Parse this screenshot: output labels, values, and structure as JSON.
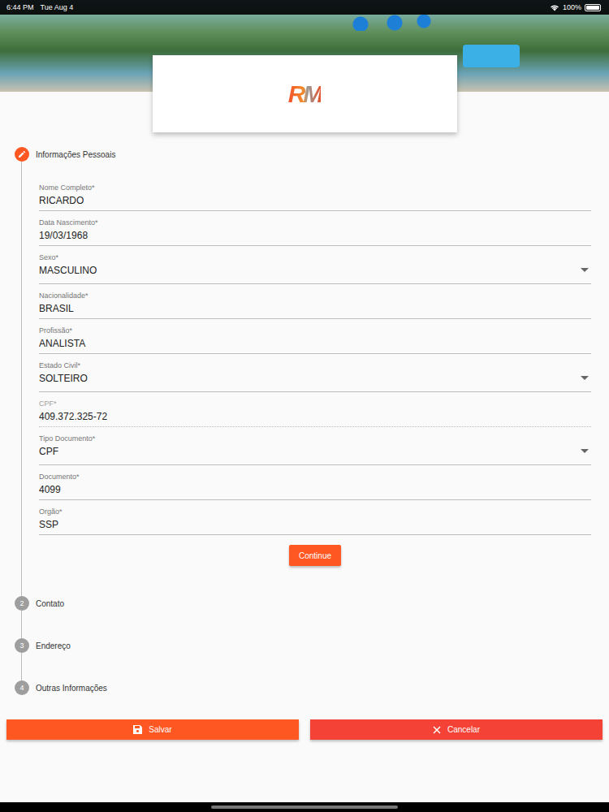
{
  "status_bar": {
    "time": "6:44 PM",
    "date": "Tue Aug 4",
    "battery": "100%",
    "battery_level": 1.0
  },
  "logo": {
    "text": "RM"
  },
  "steps": [
    {
      "label": "Informações Pessoais",
      "active": true,
      "number": ""
    },
    {
      "label": "Contato",
      "active": false,
      "number": "2"
    },
    {
      "label": "Endereço",
      "active": false,
      "number": "3"
    },
    {
      "label": "Outras Informações",
      "active": false,
      "number": "4"
    }
  ],
  "fields": [
    {
      "label": "Nome Completo*",
      "value": "RICARDO",
      "kind": "text",
      "disabled": false
    },
    {
      "label": "Data Nascimento*",
      "value": "19/03/1968",
      "kind": "text",
      "disabled": false
    },
    {
      "label": "Sexo*",
      "value": "MASCULINO",
      "kind": "select",
      "disabled": false
    },
    {
      "label": "Nacionalidade*",
      "value": "BRASIL",
      "kind": "text",
      "disabled": false
    },
    {
      "label": "Profissão*",
      "value": "ANALISTA",
      "kind": "text",
      "disabled": false
    },
    {
      "label": "Estado Civil*",
      "value": "SOLTEIRO",
      "kind": "select",
      "disabled": false
    },
    {
      "label": "CPF*",
      "value": "409.372.325-72",
      "kind": "text",
      "disabled": true
    },
    {
      "label": "Tipo Documento*",
      "value": "CPF",
      "kind": "select",
      "disabled": false
    },
    {
      "label": "Documento*",
      "value": "4099",
      "kind": "text",
      "disabled": false
    },
    {
      "label": "Orgão*",
      "value": "SSP",
      "kind": "text",
      "disabled": false
    }
  ],
  "continue_button": "Continue",
  "buttons": {
    "save": "Salvar",
    "cancel": "Cancelar"
  }
}
